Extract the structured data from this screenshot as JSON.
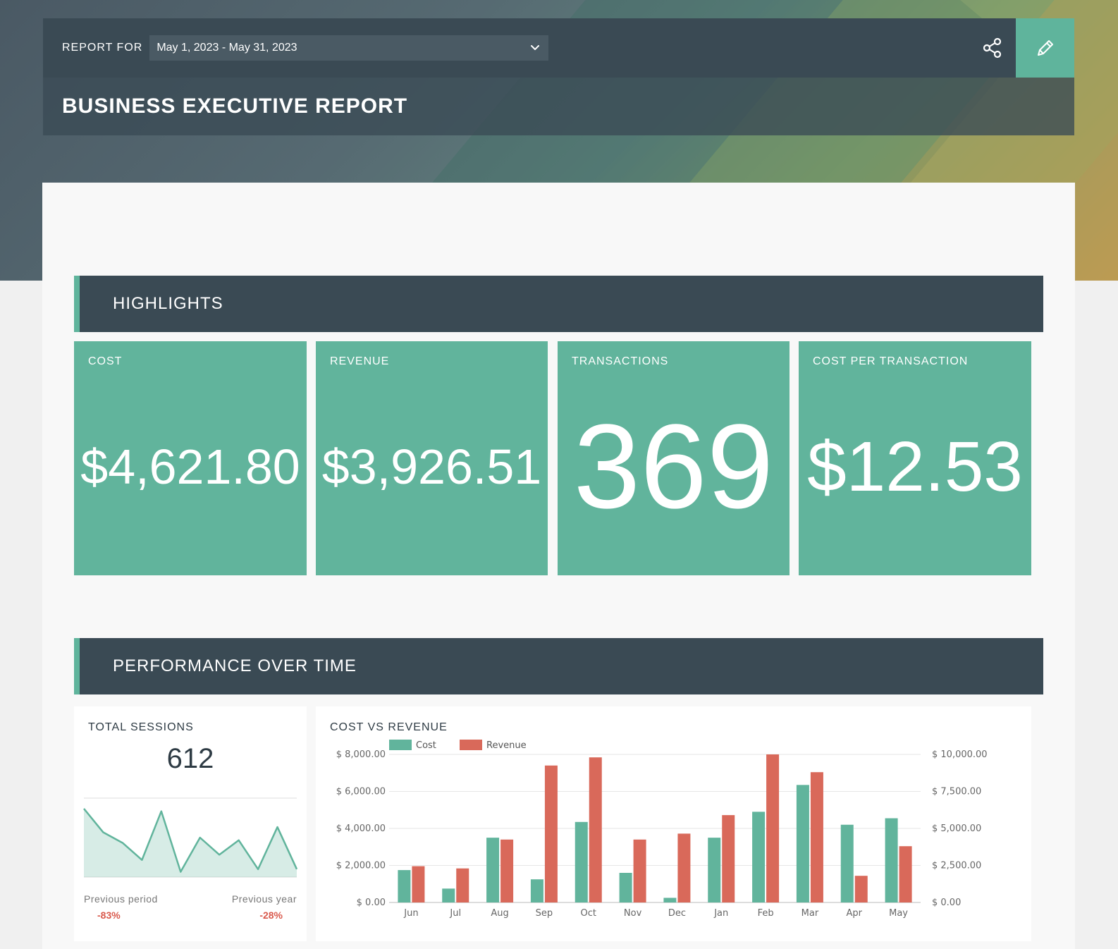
{
  "header": {
    "report_for_label": "REPORT FOR",
    "date_range": "May 1, 2023 - May 31, 2023",
    "title": "BUSINESS EXECUTIVE REPORT",
    "share_icon": "share-icon",
    "edit_icon": "pencil-icon"
  },
  "colors": {
    "dark": "#3a4a54",
    "accent": "#5fb49c",
    "cost": "#61b49c",
    "revenue": "#d9695a"
  },
  "highlights": {
    "title": "HIGHLIGHTS",
    "kpis": [
      {
        "label": "COST",
        "value": "$4,621.80"
      },
      {
        "label": "REVENUE",
        "value": "$3,926.51"
      },
      {
        "label": "TRANSACTIONS",
        "value": "369"
      },
      {
        "label": "COST PER TRANSACTION",
        "value": "$12.53"
      }
    ]
  },
  "performance": {
    "title": "PERFORMANCE OVER TIME",
    "sessions": {
      "title": "TOTAL SESSIONS",
      "value": "612",
      "previous_period_label": "Previous period",
      "previous_period_value": "-83%",
      "previous_year_label": "Previous year",
      "previous_year_value": "-28%"
    },
    "cost_vs_revenue_title": "COST VS REVENUE"
  },
  "chart_data": [
    {
      "type": "area",
      "title": "TOTAL SESSIONS",
      "values": [
        52,
        34,
        26,
        13,
        50,
        4,
        30,
        17,
        28,
        6,
        38,
        6
      ]
    },
    {
      "type": "bar",
      "title": "COST VS REVENUE",
      "categories": [
        "Jun",
        "Jul",
        "Aug",
        "Sep",
        "Oct",
        "Nov",
        "Dec",
        "Jan",
        "Feb",
        "Mar",
        "Apr",
        "May"
      ],
      "series": [
        {
          "name": "Cost",
          "axis": "left",
          "values": [
            1750,
            750,
            3500,
            1250,
            4350,
            1600,
            250,
            3500,
            4900,
            6350,
            4200,
            4550
          ]
        },
        {
          "name": "Revenue",
          "axis": "right",
          "values": [
            2450,
            2300,
            4250,
            9250,
            9800,
            4250,
            4650,
            5900,
            10000,
            8800,
            1800,
            3800
          ]
        }
      ],
      "left_axis": {
        "ticks": [
          "$ 0.00",
          "$ 2,000.00",
          "$ 4,000.00",
          "$ 6,000.00",
          "$ 8,000.00"
        ],
        "ylim": [
          0,
          8000
        ]
      },
      "right_axis": {
        "ticks": [
          "$ 0.00",
          "$ 2,500.00",
          "$ 5,000.00",
          "$ 7,500.00",
          "$ 10,000.00"
        ],
        "ylim": [
          0,
          10000
        ]
      },
      "legend": "top-left",
      "grid": true
    }
  ]
}
